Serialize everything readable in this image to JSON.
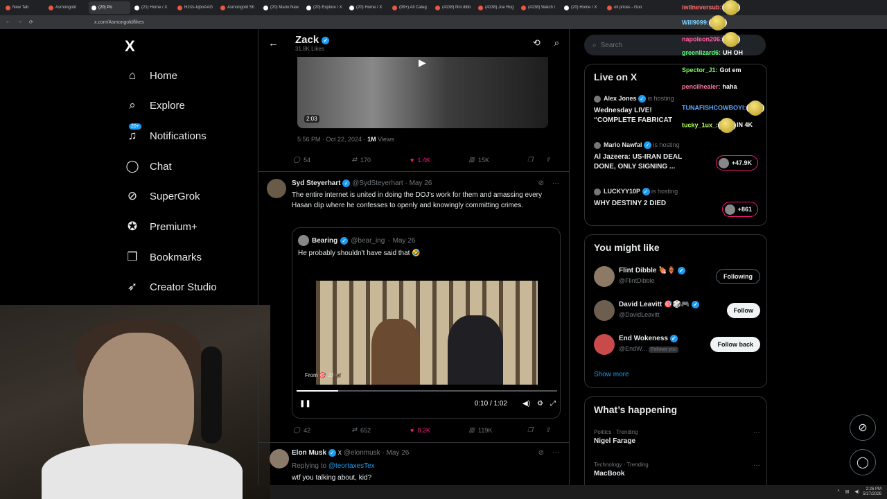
{
  "browser": {
    "tabs": [
      "New Tab",
      "Asmongold",
      "(20) Po",
      "(21) Home / X",
      "HJUs-IqboAAG",
      "Asmongold Sh",
      "(20) Mario Naw",
      "(20) Explore / X",
      "(20) Home / X",
      "(99+) All Categ",
      "(4138) flint dibb",
      "(4138) Joe Rog",
      "(4138) Watch l",
      "(20) Home / X",
      "oil prices - Goo"
    ],
    "url": "x.com/Asmongold/likes"
  },
  "sidebar": {
    "logo": "X",
    "notifications_badge": "20+",
    "items": [
      {
        "label": "Home",
        "icon": "home-icon"
      },
      {
        "label": "Explore",
        "icon": "search-icon"
      },
      {
        "label": "Notifications",
        "icon": "bell-icon"
      },
      {
        "label": "Chat",
        "icon": "chat-icon"
      },
      {
        "label": "SuperGrok",
        "icon": "grok-icon"
      },
      {
        "label": "Premium+",
        "icon": "premium-icon"
      },
      {
        "label": "Bookmarks",
        "icon": "bookmark-icon"
      },
      {
        "label": "Creator Studio",
        "icon": "rocket-icon"
      }
    ]
  },
  "header": {
    "name": "Zack",
    "likes": "31.8K Likes"
  },
  "tweet1": {
    "video_duration": "2:03",
    "time": "5:56 PM · Oct 22, 2024 · ",
    "views_count": "1M",
    "views_label": " Views",
    "replies": "54",
    "reposts": "170",
    "likes": "1.4K",
    "analytics": "15K"
  },
  "tweet2": {
    "name": "Syd Steyerhart",
    "handle": "@SydSteyerhart",
    "date": "May 26",
    "text": "The entire internet is united in doing the DOJ's work for them and amassing every Hasan clip where he confesses to openly and knowingly committing crimes.",
    "quote": {
      "name": "Bearing",
      "handle": "@bear_ing",
      "date": "May 26",
      "text": "He probably shouldn't have said that 🤣",
      "from": "From 🎯 JJ 🦋",
      "time": "0:10 / 1:02",
      "progress": 0.16
    },
    "replies": "42",
    "reposts": "652",
    "likes": "8.2K",
    "analytics": "119K"
  },
  "tweet3": {
    "name": "Elon Musk",
    "handle": "@elonmusk",
    "date": "May 26",
    "replying": "Replying to ",
    "replying_to": "@teortaxesTex",
    "text": "wtf you talking about, kid?"
  },
  "right": {
    "search_placeholder": "Search",
    "live": {
      "title": "Live on X",
      "items": [
        {
          "host": "Alex Jones",
          "status": "is hosting",
          "title1": "Wednesday LIVE!",
          "title2": "“COMPLETE FABRICAT",
          "badge": ""
        },
        {
          "host": "Mario Nawfal",
          "status": "is hosting",
          "title1": "Al Jazeera: US-IRAN DEAL",
          "title2": "DONE, ONLY SIGNING ...",
          "badge": "+47.9K"
        },
        {
          "host": "LUCKYY10P",
          "status": "is hosting",
          "title1": "WHY DESTINY 2 DIED",
          "title2": "",
          "badge": "+861"
        }
      ]
    },
    "wtf": {
      "title": "You might like",
      "items": [
        {
          "name": "Flint Dibble 🍖🏺",
          "handle": "@FlintDibble",
          "button": "Following",
          "note": ""
        },
        {
          "name": "David Leavitt 🎯🎲🎮",
          "handle": "@DavidLeavitt",
          "button": "Follow",
          "note": ""
        },
        {
          "name": "End Wokeness",
          "handle": "@EndW...",
          "button": "Follow back",
          "note": "Follows you"
        }
      ],
      "show_more": "Show more"
    },
    "happening": {
      "title": "What’s happening",
      "items": [
        {
          "category": "Politics · Trending",
          "topic": "Nigel Farage"
        },
        {
          "category": "Technology · Trending",
          "topic": "MacBook"
        }
      ]
    }
  },
  "chat": [
    {
      "user": "iwilneversub:",
      "msg": "",
      "color": "#ff6b6b"
    },
    {
      "user": "Will9099:",
      "msg": "",
      "color": "#7fd3ff"
    },
    {
      "user": "napoleon206:",
      "msg": "",
      "color": "#ff5d9e"
    },
    {
      "user": "greenlizard6:",
      "msg": "UH OH",
      "color": "#5dff7a"
    },
    {
      "user": "Spector_J1:",
      "msg": "Got em",
      "color": "#7dff5d"
    },
    {
      "user": "pencilhealer:",
      "msg": "haha",
      "color": "#ff7aa8"
    },
    {
      "user": "TUNAFISHCOWBOYI:",
      "msg": "",
      "color": "#5da8ff"
    },
    {
      "user": "tucky_1ux_:",
      "msg": "IN 4K",
      "color": "#b8ff5d"
    }
  ],
  "taskbar": {
    "time": "2:26 PM",
    "date": "5/27/2026"
  }
}
